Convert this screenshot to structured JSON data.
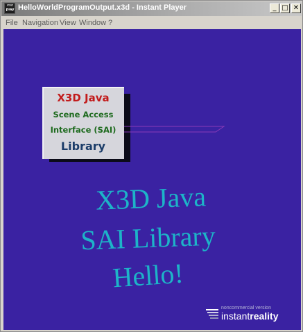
{
  "window": {
    "title": "HelloWorldProgramOutput.x3d - Instant Player",
    "app_icon": {
      "line1": "inst",
      "line2": "play"
    },
    "controls": {
      "minimize": "_",
      "maximize": "□",
      "close": "✕"
    }
  },
  "menubar": {
    "items": [
      "File",
      "Navigation",
      "View",
      "Window",
      "?"
    ]
  },
  "scene": {
    "background_color": "#3a22a2",
    "cube": {
      "line1": "X3D Java",
      "line2": "Scene Access",
      "line3": "Interface (SAI)",
      "line4": "Library"
    },
    "text3d": {
      "line1": "X3D Java",
      "line2": "SAI Library",
      "line3": "Hello!",
      "color": "#1db4c8"
    },
    "watermark": {
      "small": "noncommercial version",
      "big_part1": "instant",
      "big_part2": "reality"
    }
  }
}
